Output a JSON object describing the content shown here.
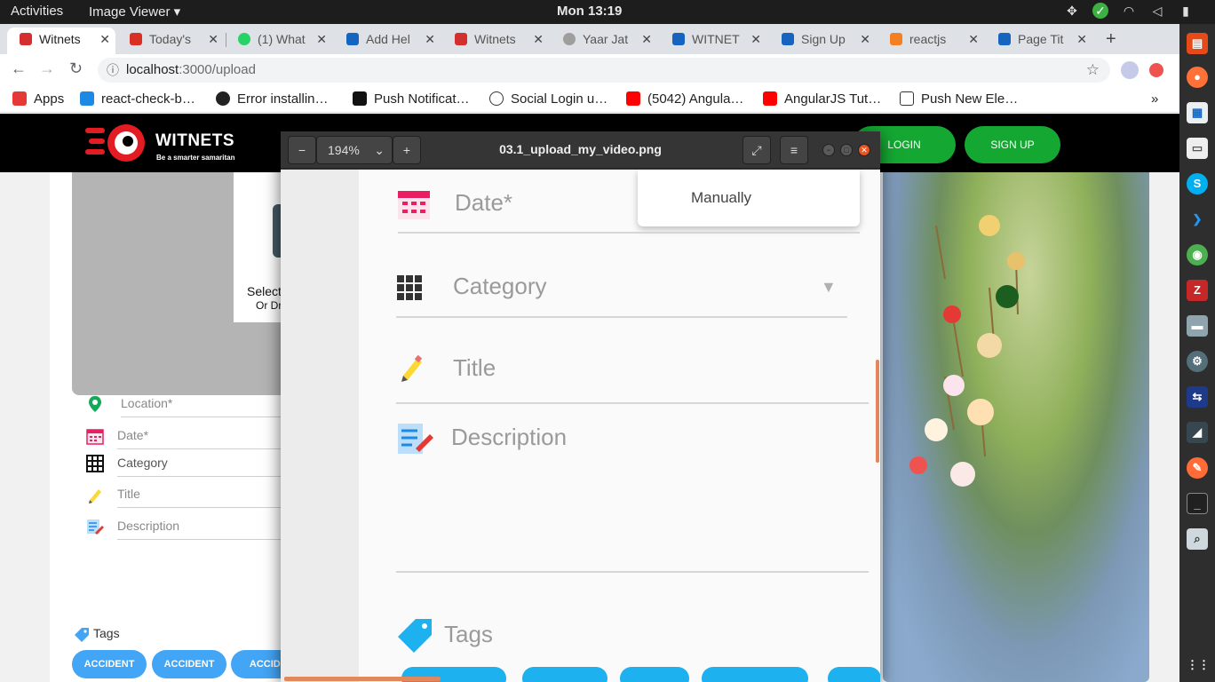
{
  "topbar": {
    "activities": "Activities",
    "app_menu": "Image Viewer ▾",
    "clock": "Mon 13:19"
  },
  "browser": {
    "tabs": [
      {
        "label": "Witnets",
        "favicon_color": "#d32f2f",
        "active": true
      },
      {
        "label": "Today's",
        "favicon_color": "#d93025"
      },
      {
        "label": "(1) What",
        "favicon_color": "#25d366"
      },
      {
        "label": "Add Hel",
        "favicon_color": "#1565c0"
      },
      {
        "label": "Witnets",
        "favicon_color": "#d32f2f"
      },
      {
        "label": "Yaar Jat",
        "favicon_color": "#9e9e9e"
      },
      {
        "label": "WITNET",
        "favicon_color": "#1565c0"
      },
      {
        "label": "Sign Up",
        "favicon_color": "#1565c0"
      },
      {
        "label": "reactjs",
        "favicon_color": "#f48024"
      },
      {
        "label": "Page Tit",
        "favicon_color": "#1565c0"
      }
    ],
    "url_host": "localhost",
    "url_path": ":3000/upload",
    "bookmarks": [
      {
        "label": "Apps",
        "icon_color": "#e53935"
      },
      {
        "label": "react-check-b…",
        "icon_color": "#1e88e5"
      },
      {
        "label": "Error installin…",
        "icon_color": "#222222"
      },
      {
        "label": "Push Notificat…",
        "icon_color": "#111111"
      },
      {
        "label": "Social Login u…",
        "icon_color": "#ffffff"
      },
      {
        "label": "(5042) Angula…",
        "icon_color": "#ff0000"
      },
      {
        "label": "AngularJS Tut…",
        "icon_color": "#ff0000"
      },
      {
        "label": "Push New Ele…",
        "icon_color": "#ffffff"
      }
    ]
  },
  "site": {
    "logo_name": "WITNETS",
    "logo_tagline": "Be a smarter samaritan",
    "login_label": "LOGIN",
    "signup_label": "SIGN UP",
    "select_text": "Select",
    "drop_text": "Or Dr",
    "fields": [
      {
        "label": "Location*",
        "icon": "location-pin-icon"
      },
      {
        "label": "Date*",
        "icon": "calendar-icon"
      },
      {
        "label": "Category",
        "icon": "grid-icon"
      },
      {
        "label": "Title",
        "icon": "pencil-icon"
      },
      {
        "label": "Description",
        "icon": "notes-icon"
      }
    ],
    "tags_label": "Tags",
    "tag_chips": [
      "ACCIDENT",
      "ACCIDENT",
      "ACCIDE"
    ],
    "accent_color": "#14a832",
    "chip_color": "#42a5f5"
  },
  "viewer": {
    "zoom": "194%",
    "filename": "03.1_upload_my_video.png",
    "image": {
      "manually_label": "Manually",
      "date_label": "Date*",
      "category_label": "Category",
      "title_label": "Title",
      "description_label": "Description",
      "tags_label": "Tags"
    }
  }
}
